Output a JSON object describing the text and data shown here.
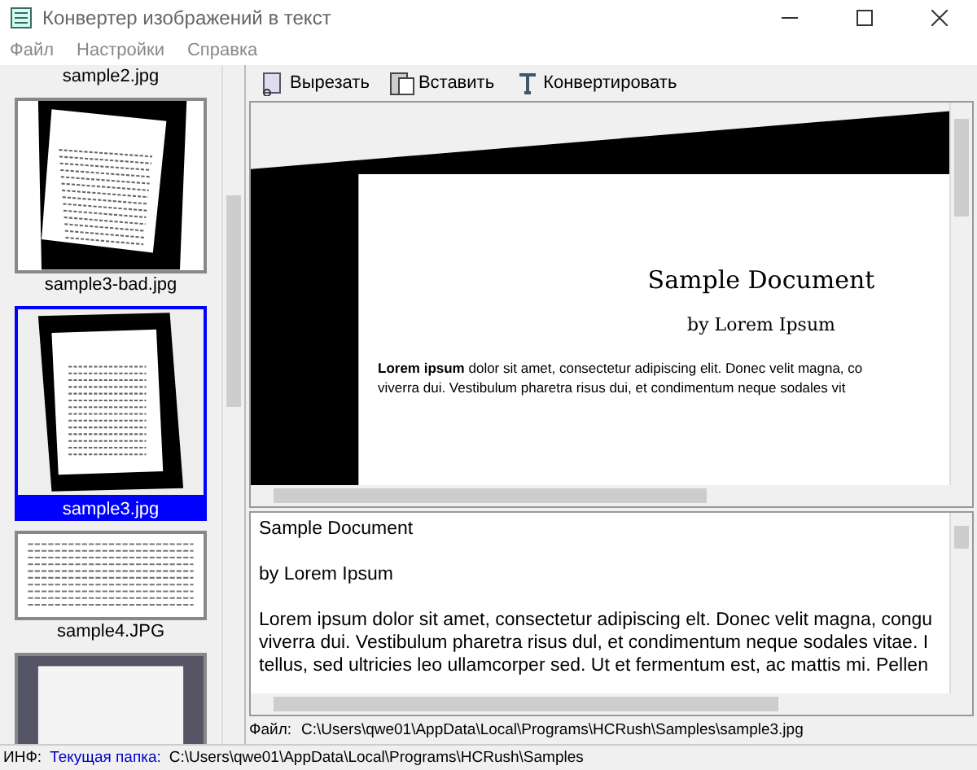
{
  "window": {
    "title": "Конвертер изображений в текст"
  },
  "menu": [
    "Файл",
    "Настройки",
    "Справка"
  ],
  "toolbar": [
    {
      "kind": "cut",
      "label": "Вырезать"
    },
    {
      "kind": "paste",
      "label": "Вставить"
    },
    {
      "kind": "convert",
      "label": "Конвертировать"
    }
  ],
  "thumbnails": [
    {
      "kind": "partial-label",
      "label": "sample2.jpg",
      "selected": false
    },
    {
      "kind": "tilted-page",
      "label": "sample3-bad.jpg",
      "selected": false
    },
    {
      "kind": "framed-page",
      "label": "sample3.jpg",
      "selected": true
    },
    {
      "kind": "text-page",
      "label": "sample4.JPG",
      "selected": false
    },
    {
      "kind": "photo",
      "selected": false
    }
  ],
  "preview": {
    "title": "Sample Document",
    "byline": "by Lorem Ipsum",
    "lines": [
      "**Lorem ipsum** dolor sit amet, consectetur adipiscing elit. Donec velit magna, co",
      "viverra dui. Vestibulum pharetra risus dui, et condimentum neque sodales vit"
    ]
  },
  "text_output": {
    "paragraphs": [
      [
        "Sample Document"
      ],
      [
        "by Lorem Ipsum"
      ],
      [
        "Lorem ipsum dolor sit amet, consectetur adipiscing elt. Donec velit magna, congu",
        "viverra dui. Vestibulum pharetra risus dul, et condimentum neque sodales vitae. I",
        "tellus, sed ultricies leo ullamcorper sed. Ut et fermentum est, ac mattis mi. Pellen"
      ]
    ]
  },
  "file_line": {
    "label": "Файл:",
    "path": "C:\\Users\\qwe01\\AppData\\Local\\Programs\\HCRush\\Samples\\sample3.jpg"
  },
  "status_bar": {
    "label": "ИНФ:",
    "folder_label": "Текущая папка:",
    "folder": "C:\\Users\\qwe01\\AppData\\Local\\Programs\\HCRush\\Samples"
  }
}
